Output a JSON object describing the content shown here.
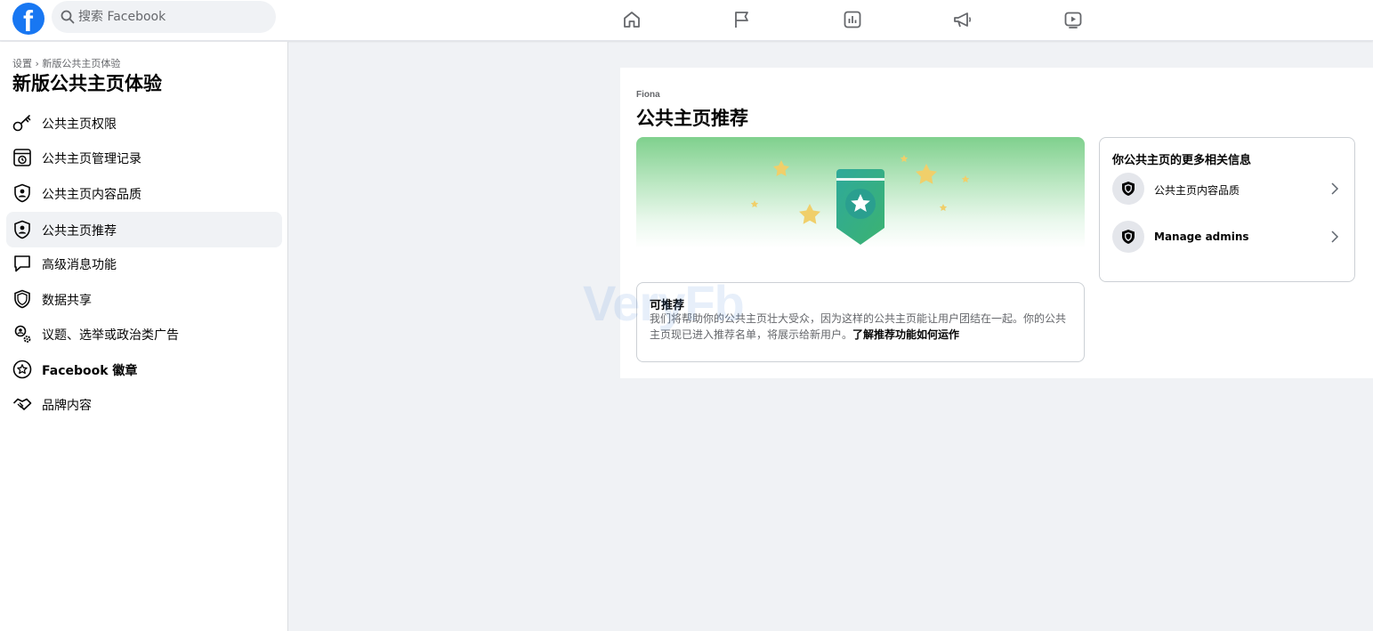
{
  "topbar": {
    "logo": "f",
    "search_placeholder": "搜索 Facebook",
    "nav_icons": [
      "home-icon",
      "flag-icon",
      "insights-icon",
      "megaphone-icon",
      "video-icon"
    ]
  },
  "sidebar": {
    "breadcrumb": "设置 › 新版公共主页体验",
    "title": "新版公共主页体验",
    "items": [
      {
        "label": "公共主页权限",
        "icon": "key-icon"
      },
      {
        "label": "公共主页管理记录",
        "icon": "history-icon"
      },
      {
        "label": "公共主页内容品质",
        "icon": "shield-person-icon"
      },
      {
        "label": "公共主页推荐",
        "icon": "shield-person-icon"
      },
      {
        "label": "高级消息功能",
        "icon": "chat-icon"
      },
      {
        "label": "数据共享",
        "icon": "shield-icon"
      },
      {
        "label": "议题、选举或政治类广告",
        "icon": "person-gear-icon"
      },
      {
        "label": "Facebook 徽章",
        "icon": "star-badge-icon"
      },
      {
        "label": "品牌内容",
        "icon": "handshake-icon"
      }
    ]
  },
  "main": {
    "page_name": "Fiona",
    "title": "公共主页推荐",
    "status_card": {
      "title": "可推荐",
      "body": "我们将帮助你的公共主页壮大受众，因为这样的公共主页能让用户团结在一起。你的公共主页现已进入推荐名单，将展示给新用户。",
      "link": "了解推荐功能如何运作"
    },
    "side_card": {
      "title": "你公共主页的更多相关信息",
      "rows": [
        {
          "label": "公共主页内容品质"
        },
        {
          "label": "Manage admins"
        }
      ]
    }
  },
  "watermark": "VeryFb",
  "colors": {
    "brand": "#1877f2",
    "badge_teal": "#2ea99a",
    "badge_green": "#3cb371",
    "star": "#f0cf6a"
  }
}
